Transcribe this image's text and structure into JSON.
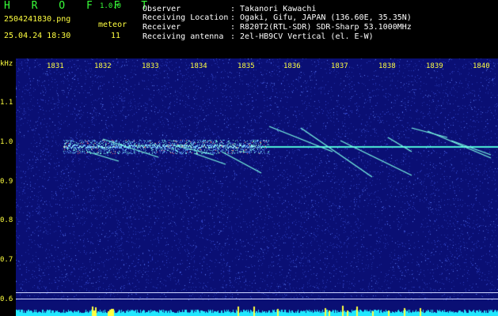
{
  "header": {
    "brand": "H R O F F T",
    "version": "1.0.0",
    "filename": "2504241830.png",
    "datetime": "25.04.24 18:30",
    "meteor_label": "meteor",
    "meteor_count": "11",
    "fields": [
      {
        "label": "Observer",
        "value": ": Takanori Kawachi"
      },
      {
        "label": "Receiving Location",
        "value": ": Ogaki, Gifu, JAPAN (136.60E, 35.35N)"
      },
      {
        "label": "Receiver",
        "value": ": R820T2(RTL-SDR) SDR-Sharp 53.1000MHz"
      },
      {
        "label": "Receiving antenna",
        "value": ": 2el-HB9CV Vertical (el. E-W)"
      }
    ]
  },
  "axes": {
    "y_unit": "kHz",
    "y_ticks": [
      "1.1",
      "1.0",
      "0.9",
      "0.8",
      "0.7",
      "0.6"
    ],
    "x_ticks": [
      "1831",
      "1832",
      "1833",
      "1834",
      "1835",
      "1836",
      "1837",
      "1838",
      "1839",
      "1840"
    ]
  },
  "colors": {
    "background": "#0a0f74",
    "carrier": "#4ff0d8",
    "meteor": "#7cffe6",
    "hot": "#ff7070",
    "noise_floor": "#21e8ff"
  }
}
